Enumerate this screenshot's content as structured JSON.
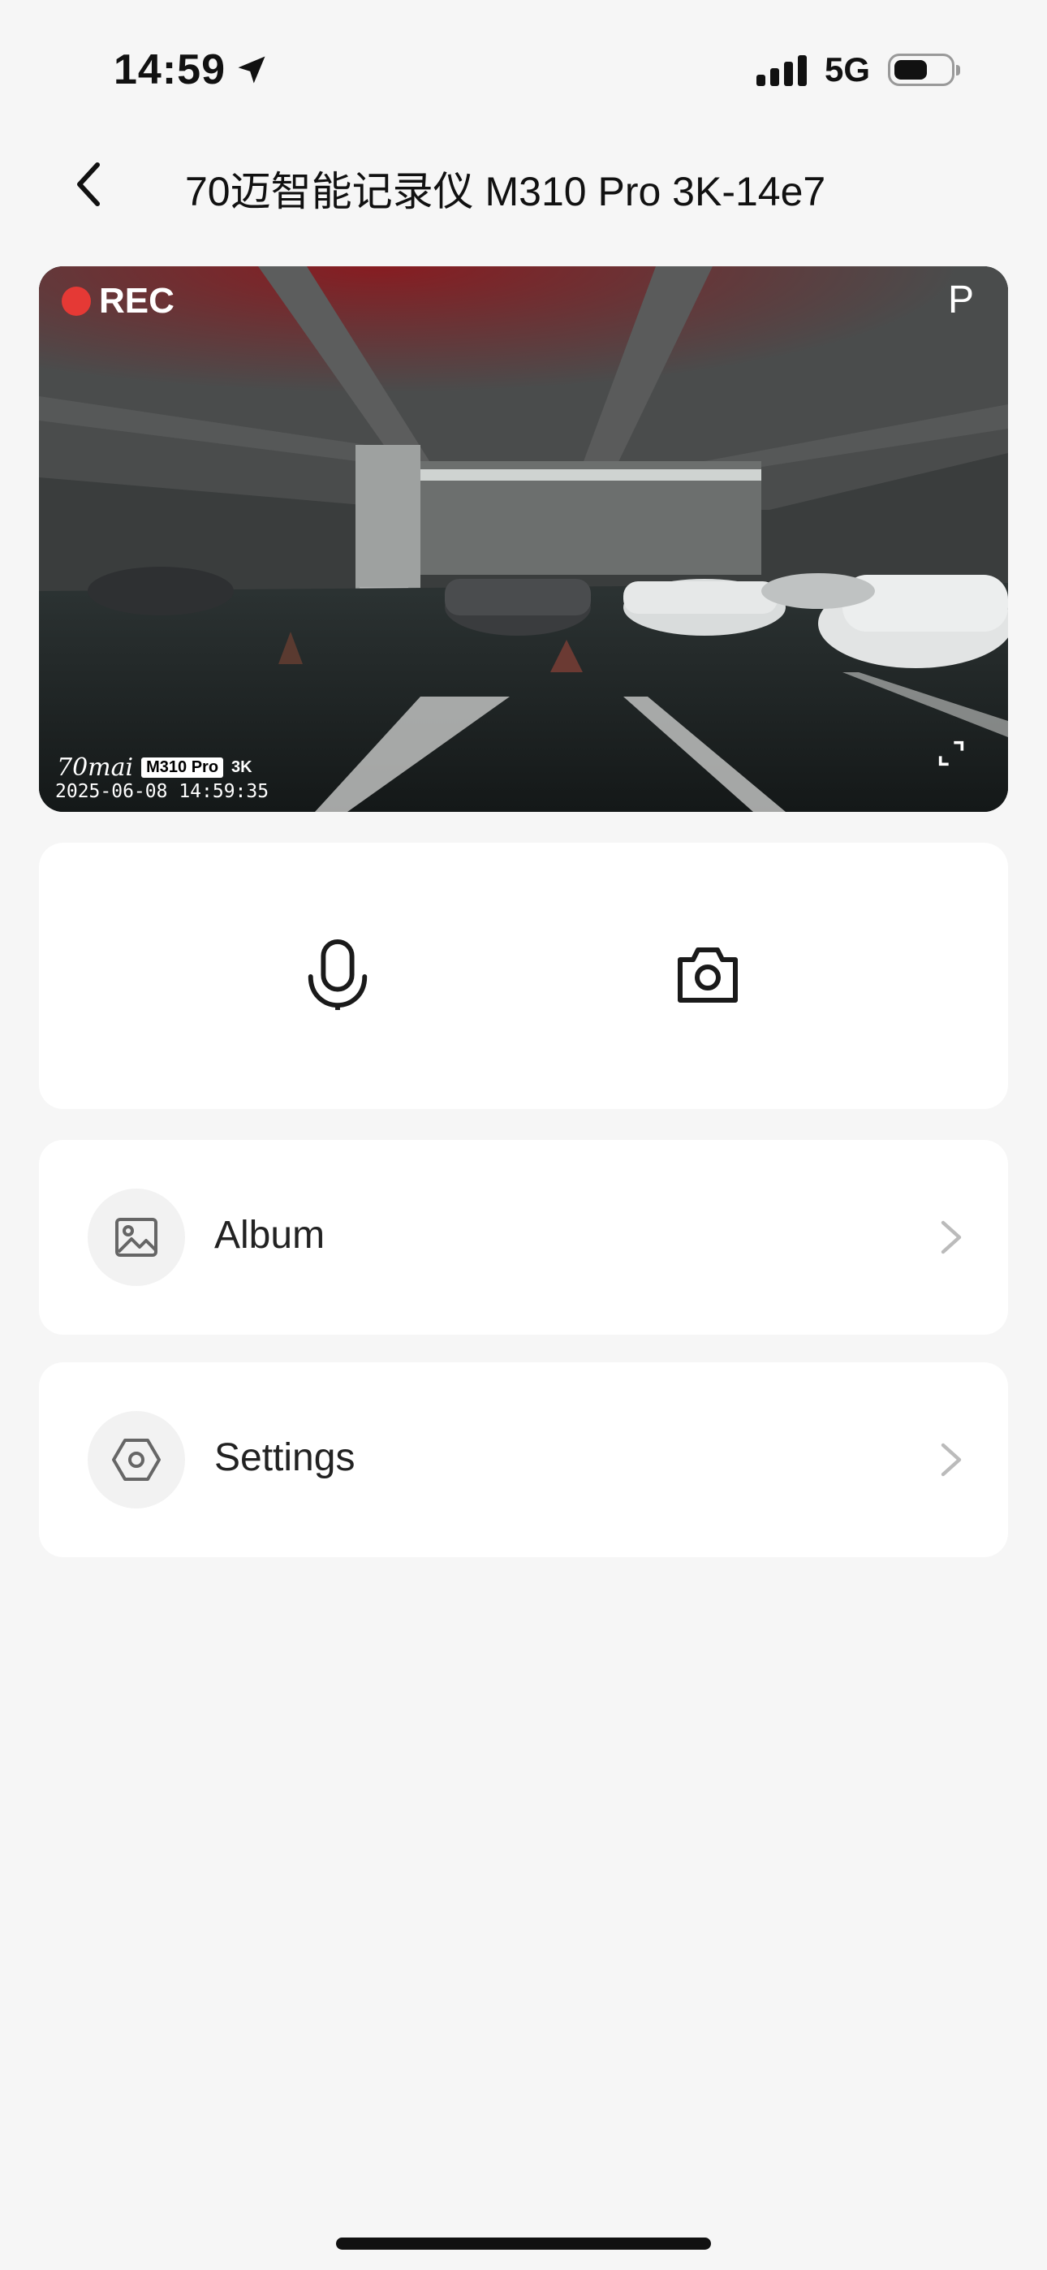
{
  "status_bar": {
    "time": "14:59",
    "network": "5G",
    "icons": [
      "location-arrow-icon",
      "cellular-signal-icon",
      "battery-icon"
    ]
  },
  "nav": {
    "title": "70迈智能记录仪 M310 Pro 3K-14e7",
    "back_icon": "chevron-left-icon"
  },
  "video": {
    "rec_label": "REC",
    "mode": "P",
    "brand": "70mai",
    "model": "M310 Pro",
    "resolution": "3K",
    "timestamp": "2025-06-08 14:59:35",
    "fullscreen_icon": "expand-icon"
  },
  "controls": {
    "mic_icon": "microphone-icon",
    "camera_icon": "camera-icon"
  },
  "menu": {
    "items": [
      {
        "label": "Album",
        "icon": "image-icon"
      },
      {
        "label": "Settings",
        "icon": "hexagon-gear-icon"
      }
    ]
  },
  "colors": {
    "background": "#f6f6f6",
    "card": "#ffffff",
    "rec_dot": "#e53935",
    "text": "#111111"
  }
}
